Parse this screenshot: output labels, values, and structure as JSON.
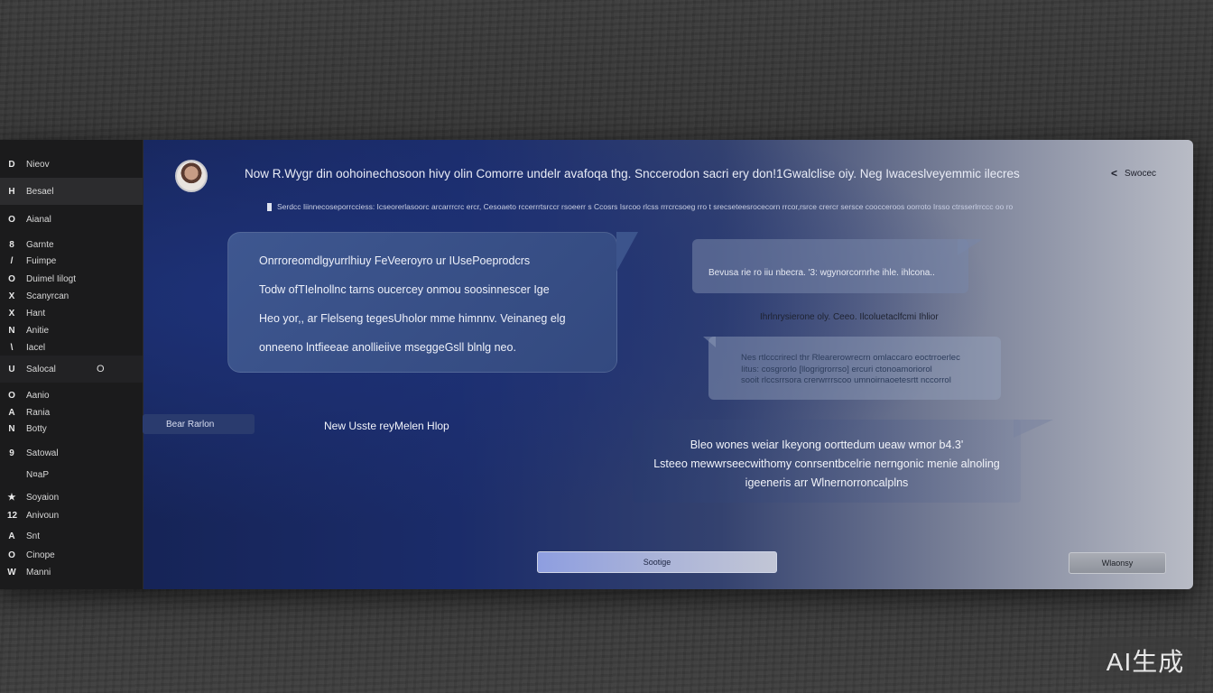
{
  "sidebar": {
    "items": [
      {
        "icon": "D",
        "label": "Nieov"
      },
      {
        "icon": "H",
        "label": "Besael"
      },
      {
        "icon": "O",
        "label": "Aianal"
      },
      {
        "icon": "8",
        "label": "Garnte"
      },
      {
        "icon": "/",
        "label": "Fuimpe"
      },
      {
        "icon": "O",
        "label": "Duimel Iilogt"
      },
      {
        "icon": "X",
        "label": "Scanyrcan"
      },
      {
        "icon": "X",
        "label": "Hant"
      },
      {
        "icon": "N",
        "label": "Anitie"
      },
      {
        "icon": "\\",
        "label": "Iacel"
      },
      {
        "icon": "U",
        "label": "Salocal",
        "badge": "O"
      },
      {
        "icon": "O",
        "label": "Aanio"
      },
      {
        "icon": "A",
        "label": "Rania"
      },
      {
        "icon": "N",
        "label": "Botty"
      },
      {
        "icon": "9",
        "label": "Satowal"
      },
      {
        "icon": "",
        "label": "N¤aP"
      },
      {
        "icon": "★",
        "label": "Soyaion"
      },
      {
        "icon": "12",
        "label": "Anivoun"
      },
      {
        "icon": "A",
        "label": "Snt"
      },
      {
        "icon": "O",
        "label": "Cinope"
      },
      {
        "icon": "W",
        "label": "Manni"
      }
    ],
    "bottom_button": "Bear Rarlon"
  },
  "header": {
    "title": "Now R.Wygr din oohoinechosoon hivy olin Comorre undelr avafoqa thg. Snccerodon sacri ery don!1Gwalclise oiy. Neg Iwaceslveyemmic ilecres",
    "collapse_label": "Swocec",
    "subtitle": "Serdcc Iiinnecoseporrcciess: Icseorerlasoorc arcarrrcrc ercr, Cesoaeto rccerrrtsrccr rsoeerr s Ccosrs Isrcoo rlcss rrrcrcsoeg rro t srecseteesrocecorn rrcor,rsrce crercr sersce coocceroos oorroto Irsso ctrsserlrrccc oo ro"
  },
  "messages": {
    "left_bubble": [
      "Onrroreomdlgyurrlhiuy FeVeeroyro ur IUsePoeprodcrs",
      "Todw ofTIelnollnc tarns oucercey onmou soosinnescer Ige",
      "Heo yor,, ar Flelseng tegesUholor mme himnnv. Veinaneg elg",
      "onneeno lntfieeae anollieiive mseggeGsll blnlg neo."
    ],
    "right_bubble_1": "Bevusa rie ro iiu nbecra. '3:  wgynorcornrhe ihle. ihlcona..",
    "caption_1": "Ihrlnrysierone oly. Ceeo. Ilcoluetaclfcmi Ihlior",
    "right_bubble_2": [
      "Nes rtlcccrirecl thr Rlearerowrecrn omlaccaro eoctrroerlec",
      "Iitus: cosgrorlo [llogrigrorrso] ercuri ctonoamoriorol",
      "sooit rlccsrrsora crerwrrrscoo umnoirnaoetesrtt nccorrol"
    ],
    "caption_2": "New Usste reyMelen Hlop",
    "right_bubble_3": [
      "Bleo wones weiar Ikeyong oorttedum ueaw wmor b4.3'",
      "Lsteeo mewwrseecwithomy conrsentbcelrie nerngonic menie alnoling",
      "igeeneris arr Wlnernorroncalplns"
    ]
  },
  "buttons": {
    "center": "Sootige",
    "right": "Wlaonsy"
  },
  "watermark": "AI生成"
}
